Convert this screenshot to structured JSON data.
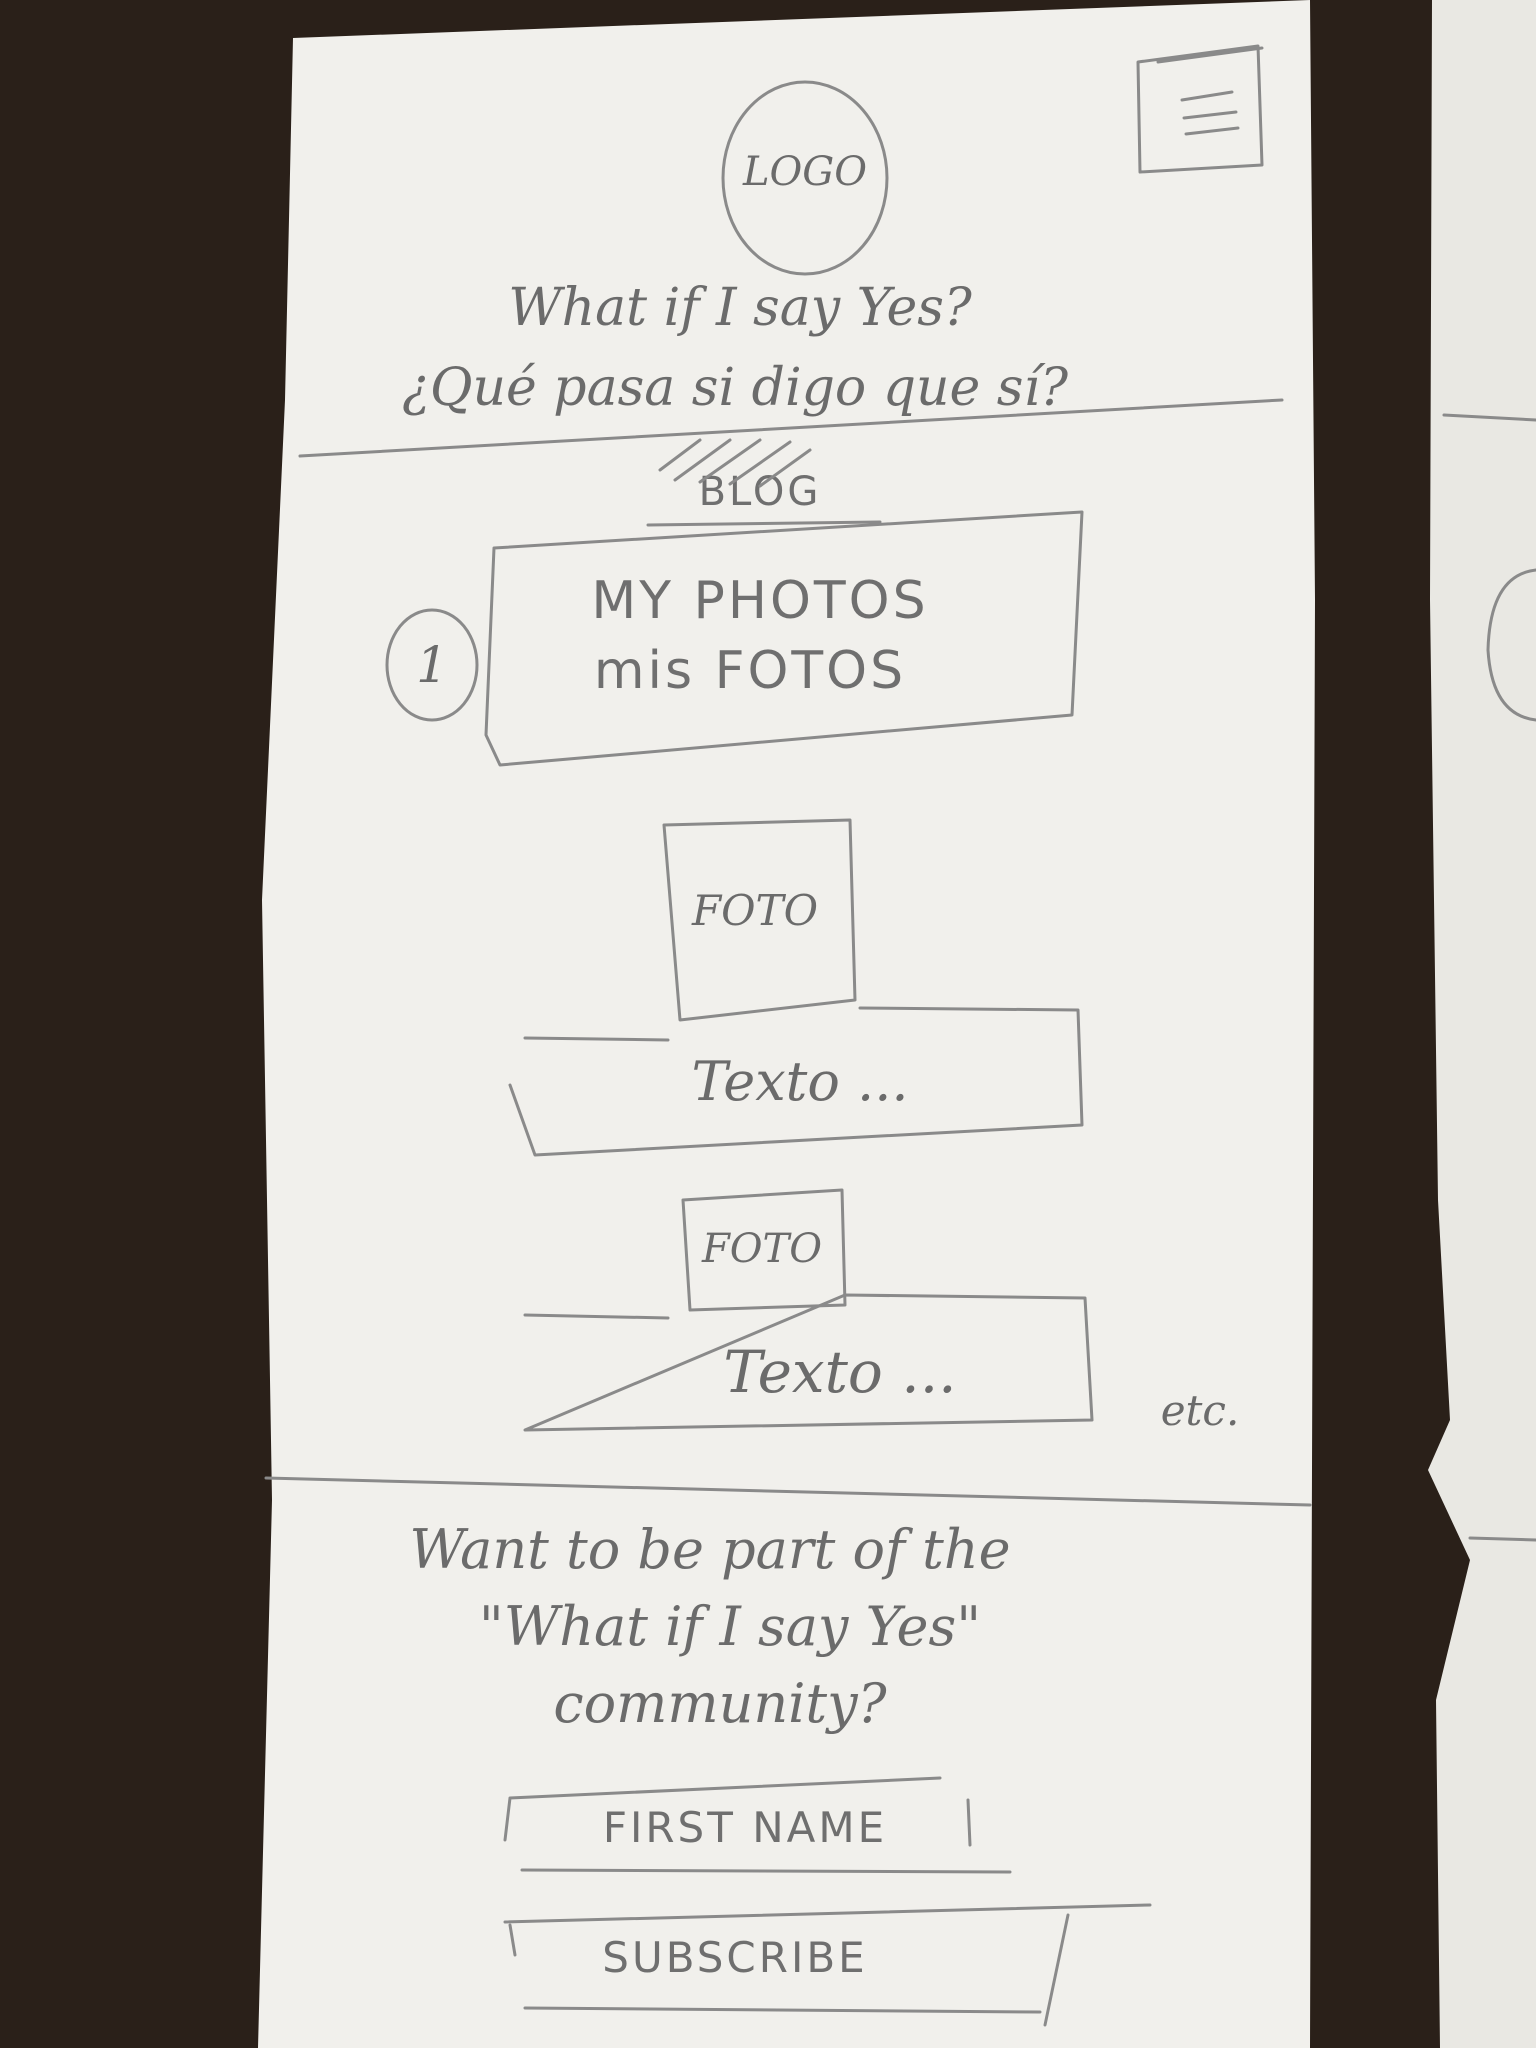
{
  "header": {
    "logo_text": "LOGO",
    "tagline_en": "What if I say Yes?",
    "tagline_es": "¿Qué pasa si digo que sí?"
  },
  "blog": {
    "heading": "BLOG"
  },
  "section": {
    "number": "1",
    "title_en": "MY PHOTOS",
    "title_es": "mis FOTOS"
  },
  "posts": [
    {
      "photo_label": "FOTO",
      "text": "Texto ..."
    },
    {
      "photo_label": "FOTO",
      "text": "Texto ..."
    }
  ],
  "more": "etc.",
  "signup": {
    "line1": "Want to be part of the",
    "line2": "\"What if I say Yes\"",
    "line3": "community?",
    "first_name_placeholder": "FIRST NAME",
    "subscribe_label": "SUBSCRIBE"
  },
  "colors": {
    "desk": "#2a2019",
    "paper": "#f1f0ec",
    "pencil": "#8a8a8a"
  }
}
